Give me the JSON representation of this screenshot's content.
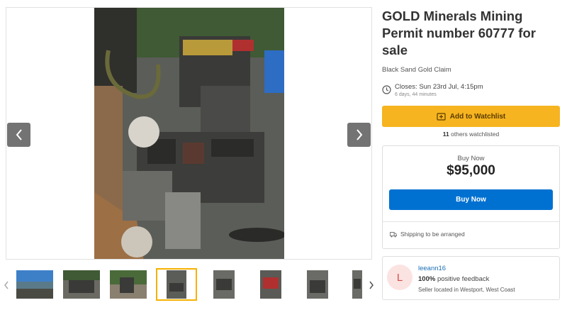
{
  "listing": {
    "title": "GOLD Minerals Mining Permit number 60777 for sale",
    "subtitle": "Black Sand Gold Claim",
    "closes": "Closes: Sun 23rd Jul, 4:15pm",
    "time_left": "6 days, 44 minutes"
  },
  "watchlist": {
    "button_label": "Add to Watchlist",
    "count": "11",
    "count_suffix": " others watchlisted"
  },
  "buy": {
    "label": "Buy Now",
    "price": "$95,000",
    "button_label": "Buy Now",
    "shipping": "Shipping to be arranged"
  },
  "seller": {
    "initial": "L",
    "name": "leeann16",
    "feedback_percent": "100%",
    "feedback_suffix": " positive feedback",
    "location": "Seller located in Westport, West Coast"
  },
  "gallery": {
    "thumbnail_count": 8,
    "selected_index": 3
  },
  "icons": {
    "prev": "chevron-left-icon",
    "next": "chevron-right-icon",
    "clock": "clock-icon",
    "watch": "watchlist-icon",
    "shipping": "shipping-icon"
  },
  "colors": {
    "watch_button": "#f6b420",
    "buy_button": "#0071d1",
    "seller_link": "#1a6fb5",
    "avatar_bg": "#fbe3e2",
    "avatar_text": "#d4504a",
    "thumb_selected": "#f5b200"
  }
}
